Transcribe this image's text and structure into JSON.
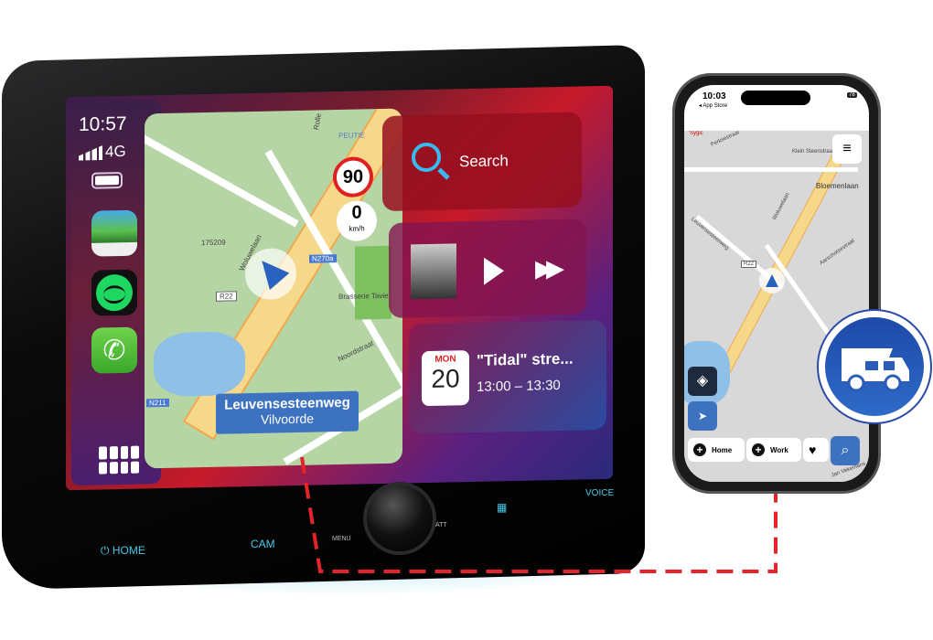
{
  "head_unit": {
    "status": {
      "time": "10:57",
      "network": "4G"
    },
    "dock_apps": [
      {
        "name": "Sygic",
        "icon": "sygic-nav-icon"
      },
      {
        "name": "Spotify",
        "icon": "spotify-icon"
      },
      {
        "name": "Phone",
        "icon": "phone-icon"
      }
    ],
    "map": {
      "speed_limit": "90",
      "current_speed": "0",
      "speed_unit": "km/h",
      "street": "Leuvensesteenweg",
      "city": "Vilvoorde",
      "labels": {
        "road_main": "Woluwelaan",
        "road_ring": "R22",
        "road_n": "N211",
        "road_n2": "N270a",
        "road_north": "Noordstraat",
        "district": "PEUTIE",
        "poi": "Brasserie Tavie",
        "poi_code": "175209",
        "road_rolle": "Rolle"
      }
    },
    "search_card": {
      "label": "Search"
    },
    "calendar_card": {
      "day": "MON",
      "date": "20",
      "title": "\"Tidal\" stre...",
      "time": "13:00 – 13:30"
    },
    "buttons": {
      "home": "HOME",
      "cam": "CAM",
      "menu": "MENU",
      "att": "ATT",
      "voice": "VOICE"
    }
  },
  "phone": {
    "status": {
      "time": "10:03",
      "back": "◂ App Store",
      "battery": "78"
    },
    "map": {
      "brand": "Sygic",
      "labels": [
        "Perksestraat",
        "Klein Steenstraat",
        "Bloemenlaan",
        "Woluwelaan",
        "Leuvensesteenweg",
        "R22",
        "Aarschotsestraat",
        "Jan Vekemans"
      ]
    },
    "buttons": {
      "home": "Home",
      "work": "Work"
    }
  },
  "colors": {
    "accent_red": "#e3242b",
    "brand_blue": "#2a5cb8",
    "button_cyan": "#4ac8e8"
  }
}
